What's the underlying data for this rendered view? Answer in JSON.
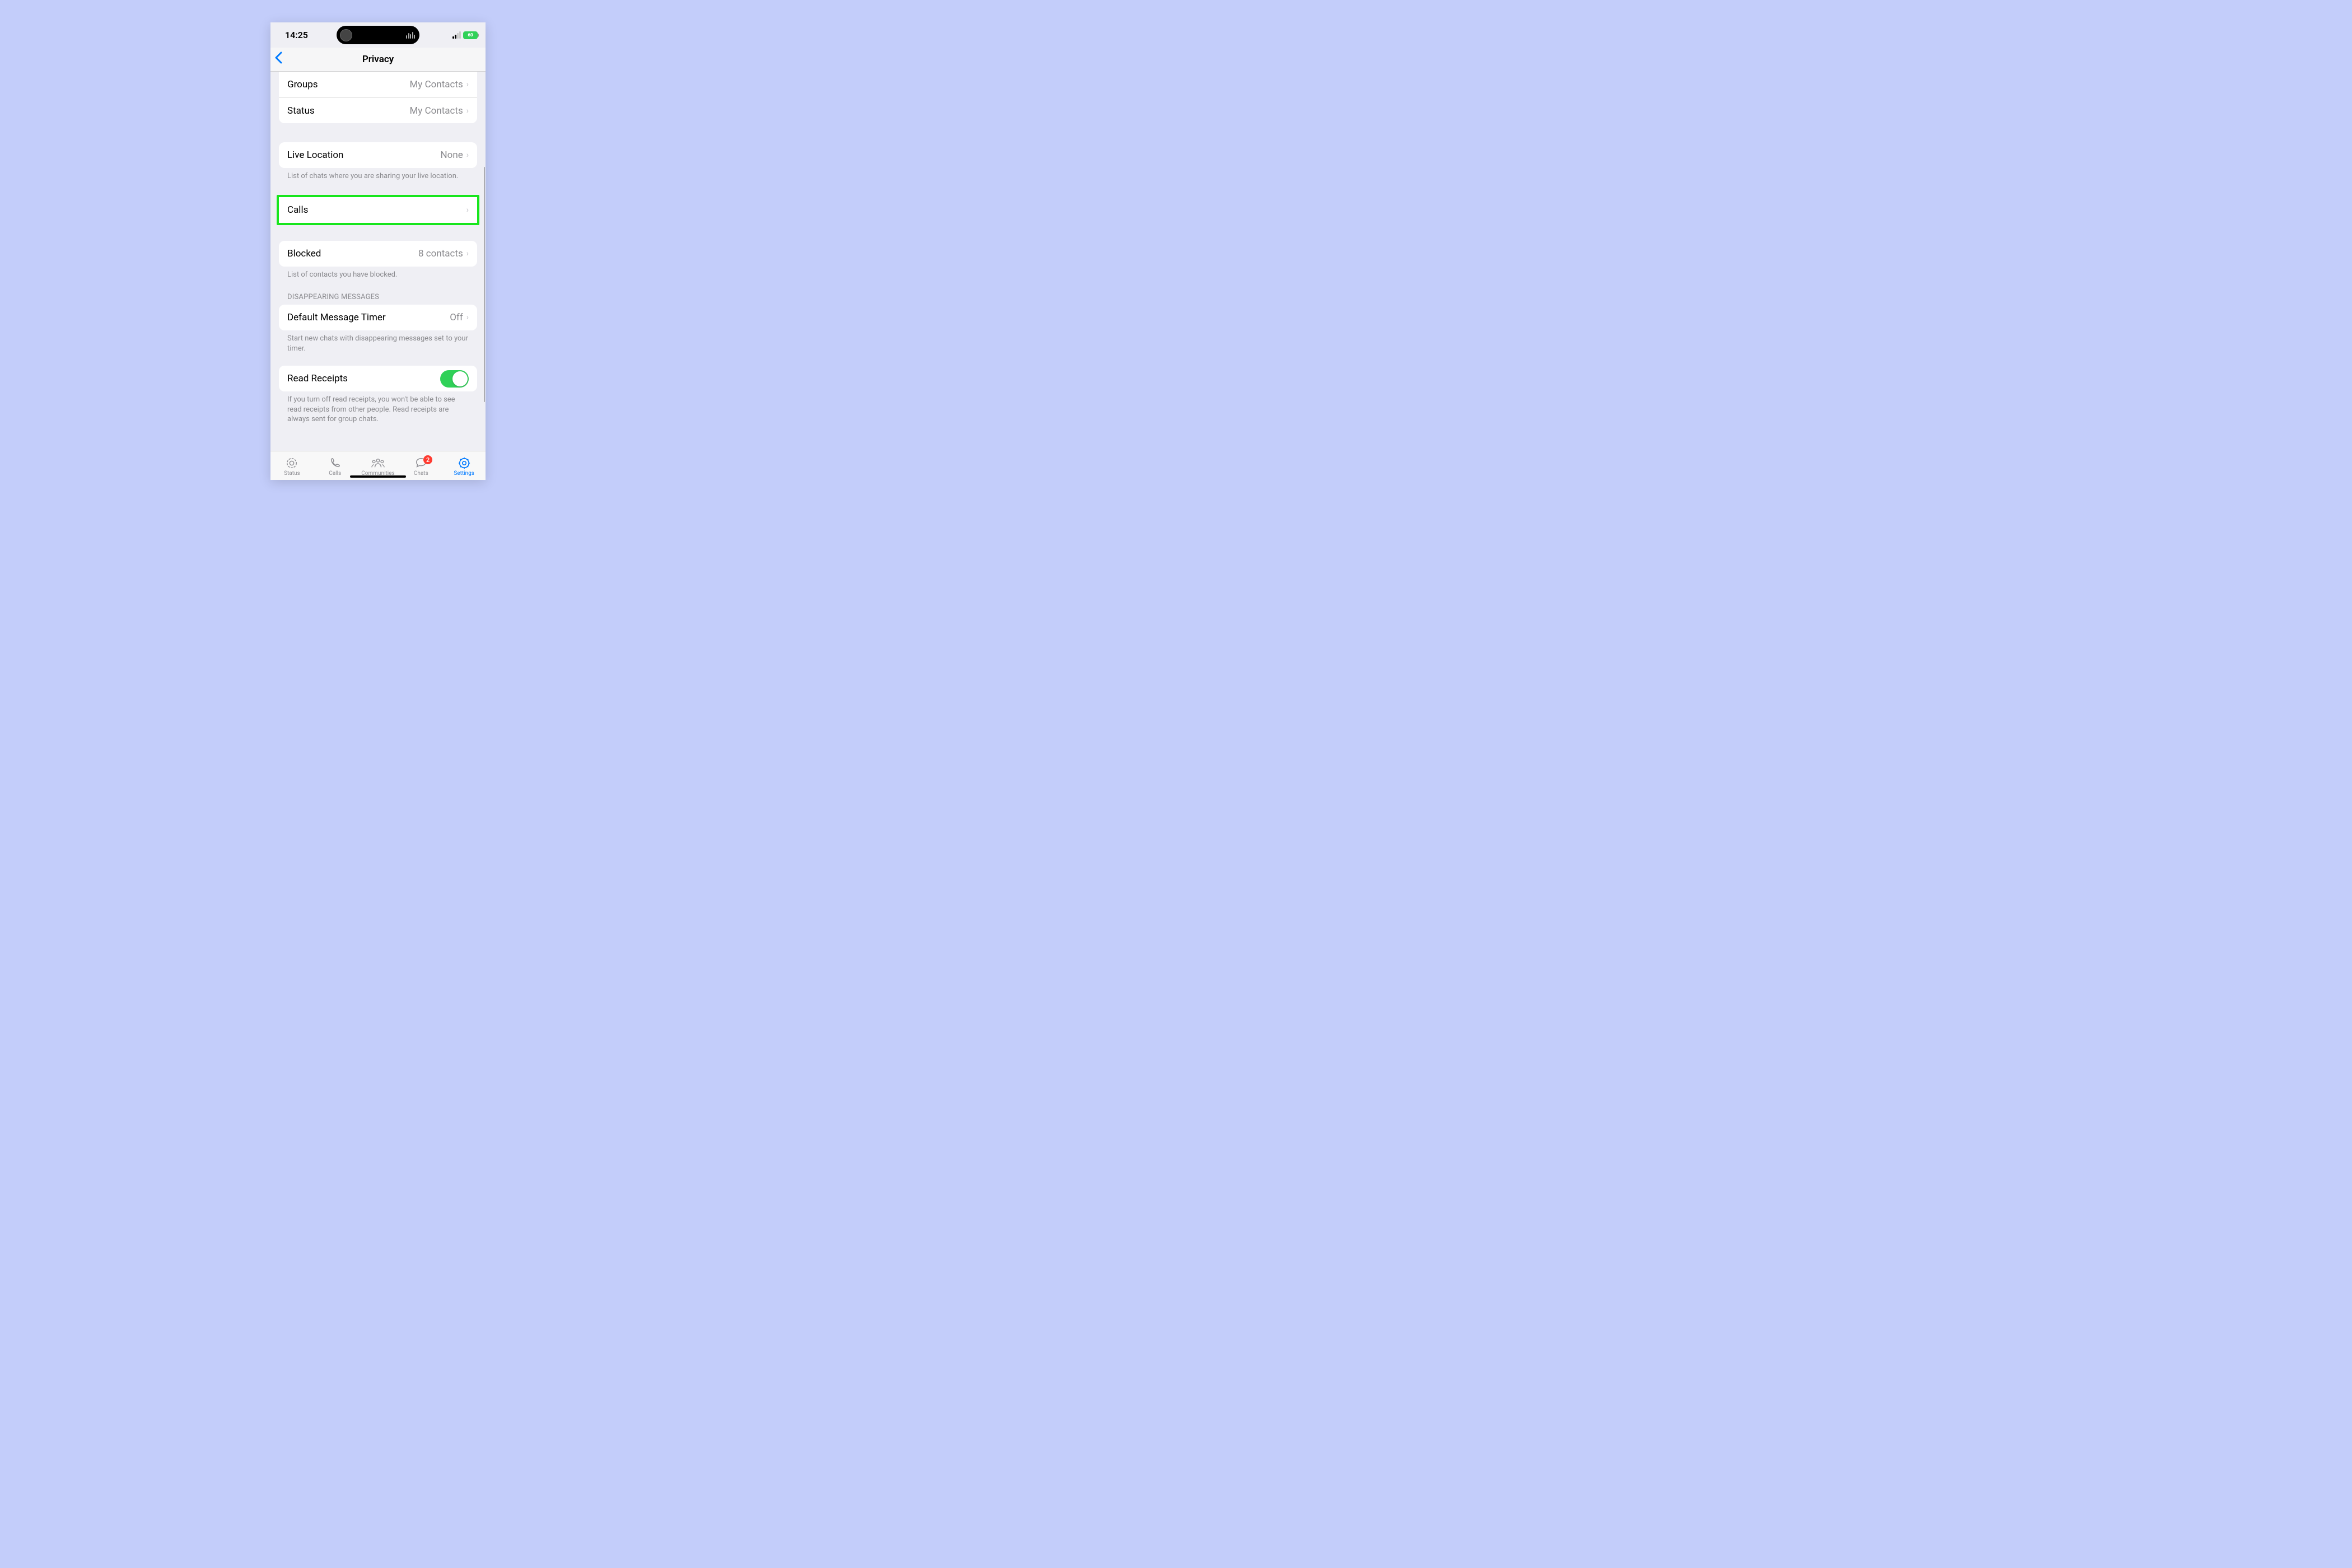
{
  "status": {
    "time": "14:25",
    "battery": "60"
  },
  "nav": {
    "title": "Privacy"
  },
  "rows": {
    "groups": {
      "label": "Groups",
      "value": "My Contacts"
    },
    "status": {
      "label": "Status",
      "value": "My Contacts"
    },
    "live_location": {
      "label": "Live Location",
      "value": "None"
    },
    "calls": {
      "label": "Calls"
    },
    "blocked": {
      "label": "Blocked",
      "value": "8 contacts"
    },
    "default_timer": {
      "label": "Default Message Timer",
      "value": "Off"
    },
    "read_receipts": {
      "label": "Read Receipts"
    }
  },
  "footers": {
    "live_location": "List of chats where you are sharing your live location.",
    "blocked": "List of contacts you have blocked.",
    "default_timer": "Start new chats with disappearing messages set to your timer.",
    "read_receipts": "If you turn off read receipts, you won't be able to see read receipts from other people. Read receipts are always sent for group chats."
  },
  "headers": {
    "disappearing": "Disappearing Messages"
  },
  "tabs": {
    "status": "Status",
    "calls": "Calls",
    "communities": "Communities",
    "chats": "Chats",
    "chats_badge": "2",
    "settings": "Settings"
  }
}
